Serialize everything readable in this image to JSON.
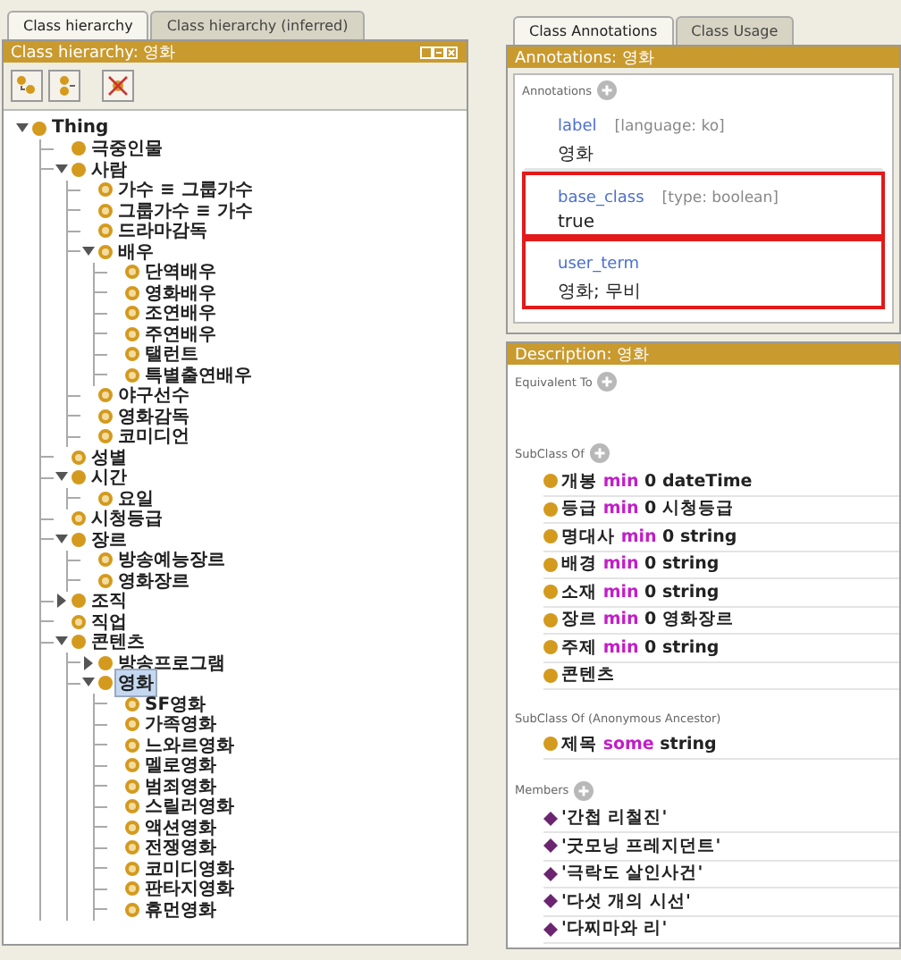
{
  "hierarchy": {
    "tabs": [
      {
        "label": "Class hierarchy",
        "selected": true
      },
      {
        "label": "Class hierarchy (inferred)",
        "selected": false
      }
    ],
    "title": "Class hierarchy: 영화",
    "tree": [
      {
        "label": "Thing",
        "kind": "filled",
        "expanded": true,
        "selected": false,
        "children": [
          {
            "label": "극중인물",
            "kind": "filled",
            "selected": false
          },
          {
            "label": "사람",
            "kind": "filled",
            "expanded": true,
            "selected": false,
            "children": [
              {
                "label": "가수 ≡ 그룹가수",
                "kind": "ring",
                "selected": false
              },
              {
                "label": "그룹가수 ≡ 가수",
                "kind": "ring",
                "selected": false
              },
              {
                "label": "드라마감독",
                "kind": "ring",
                "selected": false
              },
              {
                "label": "배우",
                "kind": "ring",
                "expanded": true,
                "selected": false,
                "children": [
                  {
                    "label": "단역배우",
                    "kind": "ring",
                    "selected": false
                  },
                  {
                    "label": "영화배우",
                    "kind": "ring",
                    "selected": false
                  },
                  {
                    "label": "조연배우",
                    "kind": "ring",
                    "selected": false
                  },
                  {
                    "label": "주연배우",
                    "kind": "ring",
                    "selected": false
                  },
                  {
                    "label": "탤런트",
                    "kind": "ring",
                    "selected": false
                  },
                  {
                    "label": "특별출연배우",
                    "kind": "ring",
                    "selected": false
                  }
                ]
              },
              {
                "label": "야구선수",
                "kind": "ring",
                "selected": false
              },
              {
                "label": "영화감독",
                "kind": "ring",
                "selected": false
              },
              {
                "label": "코미디언",
                "kind": "ring",
                "selected": false
              }
            ]
          },
          {
            "label": "성별",
            "kind": "ring",
            "selected": false
          },
          {
            "label": "시간",
            "kind": "filled",
            "expanded": true,
            "selected": false,
            "children": [
              {
                "label": "요일",
                "kind": "ring",
                "selected": false
              }
            ]
          },
          {
            "label": "시청등급",
            "kind": "ring",
            "selected": false
          },
          {
            "label": "장르",
            "kind": "filled",
            "expanded": true,
            "selected": false,
            "children": [
              {
                "label": "방송예능장르",
                "kind": "ring",
                "selected": false
              },
              {
                "label": "영화장르",
                "kind": "ring",
                "selected": false
              }
            ]
          },
          {
            "label": "조직",
            "kind": "filled",
            "expanded": false,
            "selected": false
          },
          {
            "label": "직업",
            "kind": "ring",
            "selected": false
          },
          {
            "label": "콘텐츠",
            "kind": "filled",
            "expanded": true,
            "selected": false,
            "children": [
              {
                "label": "방송프로그램",
                "kind": "filled",
                "expanded": false,
                "selected": false
              },
              {
                "label": "영화",
                "kind": "filled",
                "expanded": true,
                "selected": true,
                "children": [
                  {
                    "label": "SF영화",
                    "kind": "ring",
                    "selected": false
                  },
                  {
                    "label": "가족영화",
                    "kind": "ring",
                    "selected": false
                  },
                  {
                    "label": "느와르영화",
                    "kind": "ring",
                    "selected": false
                  },
                  {
                    "label": "멜로영화",
                    "kind": "ring",
                    "selected": false
                  },
                  {
                    "label": "범죄영화",
                    "kind": "ring",
                    "selected": false
                  },
                  {
                    "label": "스릴러영화",
                    "kind": "ring",
                    "selected": false
                  },
                  {
                    "label": "액션영화",
                    "kind": "ring",
                    "selected": false
                  },
                  {
                    "label": "전쟁영화",
                    "kind": "ring",
                    "selected": false
                  },
                  {
                    "label": "코미디영화",
                    "kind": "ring",
                    "selected": false
                  },
                  {
                    "label": "판타지영화",
                    "kind": "ring",
                    "selected": false
                  },
                  {
                    "label": "휴먼영화",
                    "kind": "ring",
                    "selected": false
                  }
                ]
              }
            ]
          }
        ]
      }
    ]
  },
  "annotations": {
    "tabs": [
      {
        "label": "Class Annotations",
        "selected": true
      },
      {
        "label": "Class Usage",
        "selected": false
      }
    ],
    "title": "Annotations: 영화",
    "section": "Annotations",
    "items": [
      {
        "property": "label",
        "meta": "[language: ko]",
        "value": "영화",
        "highlighted": false
      },
      {
        "property": "base_class",
        "meta": "[type: boolean]",
        "value": "true",
        "highlighted": true
      },
      {
        "property": "user_term",
        "value": "영화; 무비",
        "highlighted": true
      }
    ]
  },
  "description": {
    "title": "Description: 영화",
    "sections": [
      {
        "heading": "Equivalent To",
        "addable": true
      },
      {
        "heading": "SubClass Of",
        "addable": true,
        "items": [
          {
            "kind": "restriction",
            "property": "개봉",
            "keyword": "min",
            "filler": "0 dateTime"
          },
          {
            "kind": "restriction",
            "property": "등급",
            "keyword": "min",
            "filler": "0 시청등급"
          },
          {
            "kind": "restriction",
            "property": "명대사",
            "keyword": "min",
            "filler": "0 string"
          },
          {
            "kind": "restriction",
            "property": "배경",
            "keyword": "min",
            "filler": "0 string"
          },
          {
            "kind": "restriction",
            "property": "소재",
            "keyword": "min",
            "filler": "0 string"
          },
          {
            "kind": "restriction",
            "property": "장르",
            "keyword": "min",
            "filler": "0 영화장르"
          },
          {
            "kind": "restriction",
            "property": "주제",
            "keyword": "min",
            "filler": "0 string"
          },
          {
            "kind": "class",
            "property": "콘텐츠"
          }
        ]
      },
      {
        "heading": "SubClass Of (Anonymous Ancestor)",
        "addable": false,
        "items": [
          {
            "kind": "restriction",
            "property": "제목",
            "keyword": "some",
            "filler": "string"
          }
        ]
      },
      {
        "heading": "Members",
        "addable": true,
        "items": [
          {
            "kind": "individual",
            "property": "'간첩 리철진'"
          },
          {
            "kind": "individual",
            "property": "'굿모닝 프레지던트'"
          },
          {
            "kind": "individual",
            "property": "'극락도 살인사건'"
          },
          {
            "kind": "individual",
            "property": "'다섯 개의 시선'"
          },
          {
            "kind": "individual",
            "property": "'다찌마와 리'"
          }
        ]
      }
    ]
  }
}
